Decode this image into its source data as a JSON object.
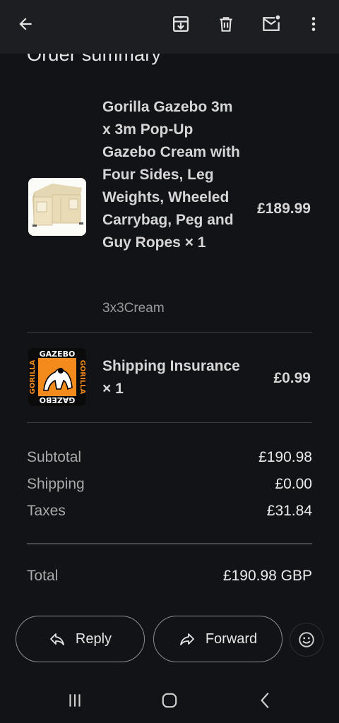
{
  "appbar": {
    "back_icon": "arrow-left-icon",
    "archive_icon": "archive-icon",
    "delete_icon": "trash-icon",
    "unread_icon": "mail-unread-icon",
    "more_icon": "more-vert-icon"
  },
  "order": {
    "title": "Order summary",
    "items": [
      {
        "name": "Gorilla Gazebo 3m x 3m Pop-Up Gazebo Cream with Four Sides, Leg Weights, Wheeled Carrybag, Peg and Guy Ropes × 1",
        "variant": "3x3Cream",
        "price": "£189.99",
        "image": "gazebo-image"
      },
      {
        "name": "Shipping Insurance × 1",
        "price": "£0.99",
        "image": "gorilla-gazebo-logo",
        "logo_text": [
          "GAZEBO",
          "GORILLA",
          "GAZEBO"
        ]
      }
    ],
    "summary": {
      "subtotal_label": "Subtotal",
      "subtotal": "£190.98",
      "shipping_label": "Shipping",
      "shipping": "£0.00",
      "taxes_label": "Taxes",
      "taxes": "£31.84",
      "total_label": "Total",
      "total": "£190.98 GBP"
    }
  },
  "actions": {
    "reply": "Reply",
    "forward": "Forward",
    "emoji_icon": "emoji-smile-icon"
  },
  "colors": {
    "background": "#121316",
    "appbar": "#1d1e22",
    "logo_orange": "#f38b1c"
  }
}
